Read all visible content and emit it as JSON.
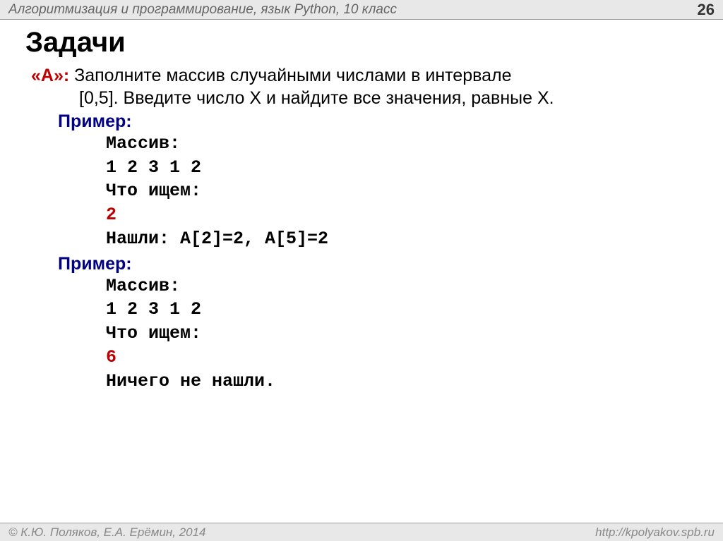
{
  "header": {
    "title": "Алгоритмизация и программирование, язык Python, 10 класс",
    "page_number": "26"
  },
  "main": {
    "title": "Задачи",
    "task_label": "«A»:",
    "task_desc_line1": " Заполните массив случайными числами в интервале",
    "task_desc_line2": "[0,5]. Введите число X и найдите все значения, равные X.",
    "example_label": "Пример:",
    "example1": {
      "line1": "Массив:",
      "line2": "1 2 3 1 2",
      "line3": "Что ищем:",
      "line4": "2",
      "line5": "Нашли: A[2]=2, A[5]=2"
    },
    "example2": {
      "line1": "Массив:",
      "line2": "1 2 3 1 2",
      "line3": "Что ищем:",
      "line4": "6",
      "line5": "Ничего не нашли."
    }
  },
  "footer": {
    "copyright": "© К.Ю. Поляков, Е.А. Ерёмин, 2014",
    "url": "http://kpolyakov.spb.ru"
  }
}
